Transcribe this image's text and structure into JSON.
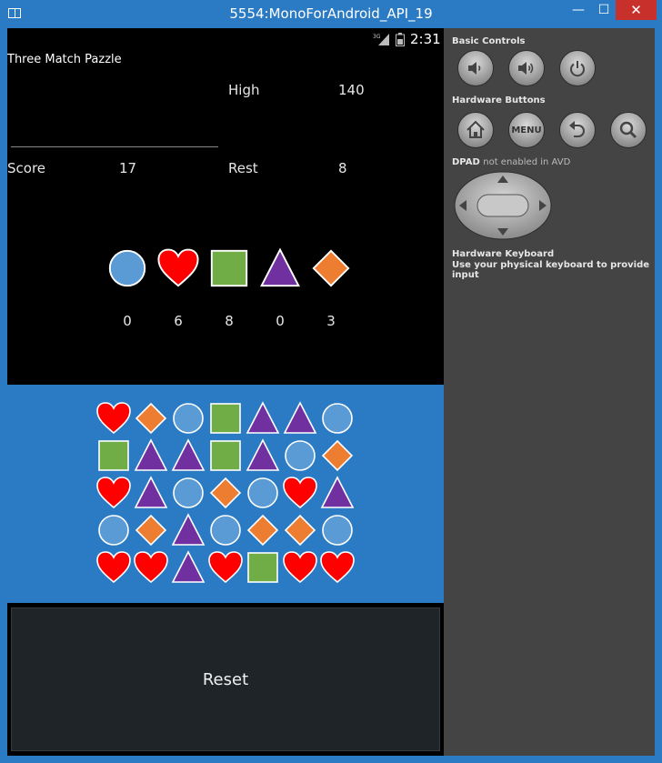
{
  "window": {
    "title": "5554:MonoForAndroid_API_19",
    "min_glyph": "—",
    "max_glyph": "☐",
    "close_glyph": "✕"
  },
  "status_bar": {
    "network": "3G",
    "time": "2:31"
  },
  "app": {
    "title": "Three Match Pazzle",
    "high_label": "High",
    "high_value": "140",
    "score_label": "Score",
    "score_value": "17",
    "rest_label": "Rest",
    "rest_value": "8",
    "piece_types": [
      {
        "shape": "circle",
        "count": "0"
      },
      {
        "shape": "heart",
        "count": "6"
      },
      {
        "shape": "square",
        "count": "8"
      },
      {
        "shape": "triangle",
        "count": "0"
      },
      {
        "shape": "diamond",
        "count": "3"
      }
    ],
    "board": [
      [
        "heart",
        "diamond",
        "circle",
        "square",
        "triangle",
        "triangle",
        "circle"
      ],
      [
        "square",
        "triangle",
        "triangle",
        "square",
        "triangle",
        "circle",
        "diamond"
      ],
      [
        "heart",
        "triangle",
        "circle",
        "diamond",
        "circle",
        "heart",
        "triangle"
      ],
      [
        "circle",
        "diamond",
        "triangle",
        "circle",
        "diamond",
        "diamond",
        "circle"
      ],
      [
        "heart",
        "heart",
        "triangle",
        "heart",
        "square",
        "heart",
        "heart"
      ]
    ],
    "reset_label": "Reset"
  },
  "colors": {
    "circle": "#5b9bd5",
    "heart": "#ff0000",
    "square": "#70ad47",
    "triangle": "#7030a0",
    "diamond": "#ed7d31",
    "board_bg": "#2a7bc4",
    "window_frame": "#2a7bc4"
  },
  "sidebar": {
    "basic_controls": "Basic Controls",
    "hardware_buttons": "Hardware Buttons",
    "menu_label": "MENU",
    "dpad_label": "DPAD",
    "dpad_note": "not enabled in AVD",
    "keyboard_title": "Hardware Keyboard",
    "keyboard_note": "Use your physical keyboard to provide input",
    "basic_icons": [
      "volume-down-icon",
      "volume-up-icon",
      "power-icon"
    ],
    "hardware_icons": [
      "home-icon",
      "menu-icon",
      "back-icon",
      "search-icon"
    ]
  }
}
